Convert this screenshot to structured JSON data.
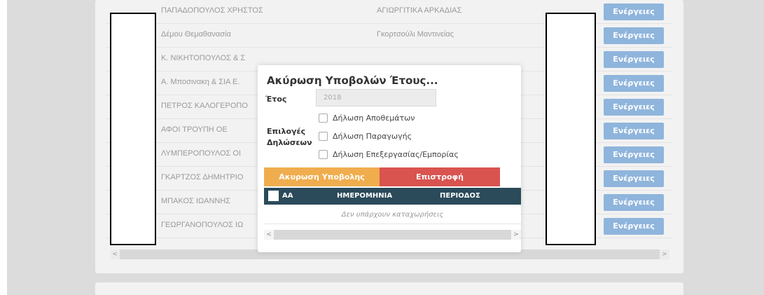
{
  "rows": [
    {
      "name": "ΠΑΠΑΔΟΠΟΥΛΟΣ ΧΡΗΣΤΟΣ",
      "place": "ΑΓΙΩΡΓΙΤΙΚΑ ΑΡΚΑΔΙΑΣ",
      "action": "Ενέργειες"
    },
    {
      "name": "Δέμου Θεμαθανασία",
      "place": "Γκορτσούλι Μαντινείας",
      "action": "Ενέργειες"
    },
    {
      "name": "Κ. ΝΙΚΗΤΟΠΟΥΛΟΣ & Σ",
      "place": "",
      "action": "Ενέργειες"
    },
    {
      "name": "Α. Μποσινακη & ΣΙΑ Ε.",
      "place": "",
      "action": "Ενέργειες"
    },
    {
      "name": "ΠΕΤΡΟΣ ΚΑΛΟΓΕΡΟΠΟ",
      "place": "",
      "action": "Ενέργειες"
    },
    {
      "name": "ΑΦΟΙ ΤΡΟΥΠΗ ΟΕ",
      "place": "",
      "action": "Ενέργειες"
    },
    {
      "name": "ΛΥΜΠΕΡΟΠΟΥΛΟΣ ΟΙ",
      "place": "",
      "action": "Ενέργειες"
    },
    {
      "name": "ΓΚΑΡΤΖΟΣ ΔΗΜΗΤΡΙΟ",
      "place": "",
      "action": "Ενέργειες"
    },
    {
      "name": "ΜΠΑΚΟΣ ΙΩΑΝΝΗΣ",
      "place": "",
      "action": "Ενέργειες"
    },
    {
      "name": "ΓΕΩΡΓΑΝΟΠΟΥΛΟΣ ΙΩ",
      "place": "",
      "action": "Ενέργειες"
    }
  ],
  "modal": {
    "title": "Ακύρωση Υποβολών Έτους...",
    "year_label": "Έτος",
    "year_value": "2018",
    "declarations_label_1": "Επιλογές",
    "declarations_label_2": "Δηλώσεων",
    "options": [
      "Δήλωση Αποθεμάτων",
      "Δήλωση Παραγωγής",
      "Δήλωση Επεξεργασίας/Εμπορίας"
    ],
    "cancel_button": "Ακυρωση Υποβολης",
    "back_button": "Επιστροφή",
    "table_headers": [
      "ΑΑ",
      "ΗΜΕΡΟΜΗΝΙΑ",
      "ΠΕΡΙΟΔΟΣ"
    ],
    "empty_text": "Δεν υπάρχουν καταχωρήσεις"
  },
  "scroll": {
    "left_arrow": "<",
    "right_arrow": ">"
  }
}
